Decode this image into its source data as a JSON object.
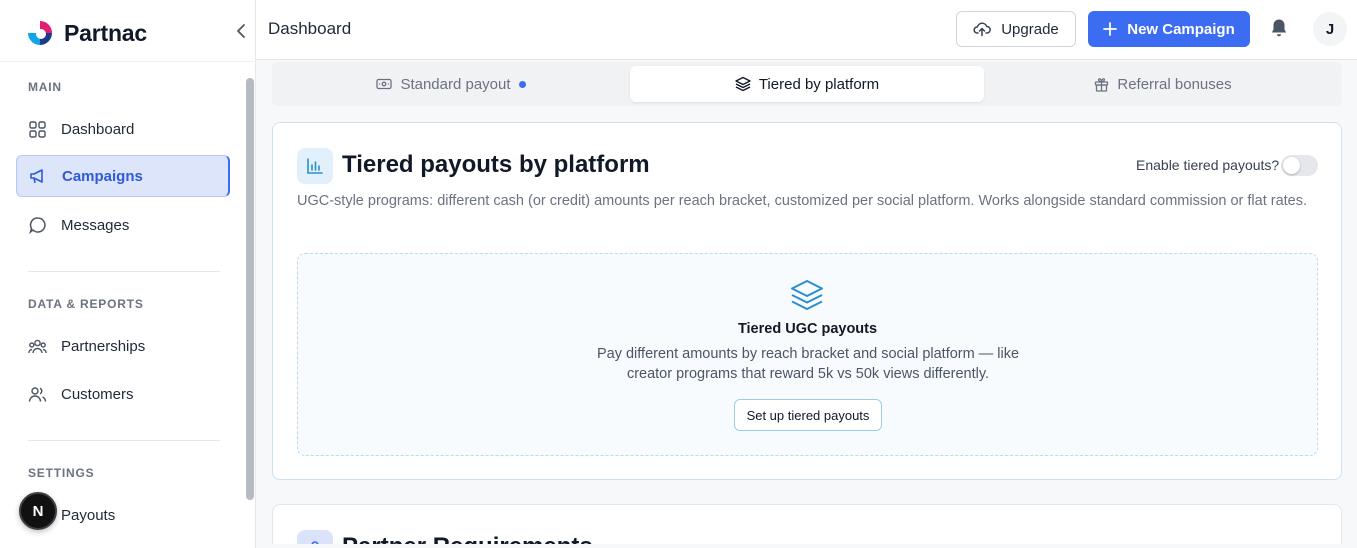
{
  "brand": {
    "name": "Partnac",
    "logo_icon": "partnac-logo"
  },
  "sidebar": {
    "collapse_icon": "chevron-left-icon",
    "sections": [
      {
        "label": "MAIN"
      },
      {
        "label": "DATA & REPORTS"
      },
      {
        "label": "SETTINGS"
      }
    ],
    "items": [
      {
        "label": "Dashboard",
        "icon": "grid-icon"
      },
      {
        "label": "Campaigns",
        "icon": "megaphone-icon",
        "active": true
      },
      {
        "label": "Messages",
        "icon": "chat-bubble-icon"
      },
      {
        "label": "Partnerships",
        "icon": "users-group-icon"
      },
      {
        "label": "Customers",
        "icon": "users-icon"
      },
      {
        "label": "Payouts",
        "icon": "payouts-icon"
      }
    ],
    "floating_badge": "N"
  },
  "header": {
    "title": "Dashboard",
    "upgrade_label": "Upgrade",
    "new_campaign_label": "New Campaign",
    "avatar_initial": "J"
  },
  "tabs": [
    {
      "label": "Standard payout",
      "icon": "banknote-icon",
      "has_dot": true
    },
    {
      "label": "Tiered by platform",
      "icon": "layers-icon",
      "active": true
    },
    {
      "label": "Referral bonuses",
      "icon": "gift-icon"
    }
  ],
  "tiered_card": {
    "title": "Tiered payouts by platform",
    "toggle_label": "Enable tiered payouts?",
    "toggle_on": false,
    "description": "UGC-style programs: different cash (or credit) amounts per reach bracket, customized per social platform. Works alongside standard commission or flat rates.",
    "empty_state": {
      "title": "Tiered UGC payouts",
      "description": "Pay different amounts by reach bracket and social platform — like creator programs that reward 5k vs 50k views differently.",
      "button_label": "Set up tiered payouts"
    }
  },
  "requirements_card": {
    "title": "Partner Requirements"
  },
  "colors": {
    "accent": "#3b6cf2",
    "active_nav_bg": "#dde5fb",
    "card_border": "#c9e3f3",
    "info_blue": "#2b8fcf"
  }
}
